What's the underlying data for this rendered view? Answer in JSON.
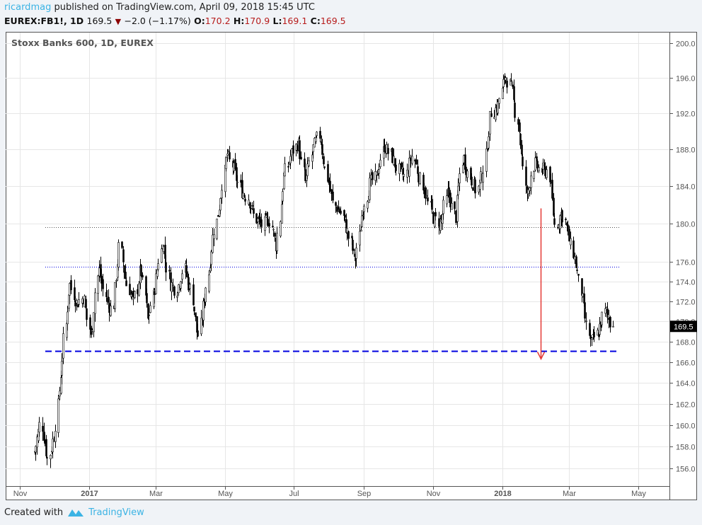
{
  "header": {
    "user": "ricardmag",
    "published": "published on TradingView.com, April 09, 2018 15:45 UTC",
    "symbol": "EUREX:FB1!, 1D",
    "last": "169.5",
    "change": "−2.0 (−1.17%)",
    "o_label": "O:",
    "o": "170.2",
    "h_label": "H:",
    "h": "170.9",
    "l_label": "L:",
    "l": "169.1",
    "c_label": "C:",
    "c": "169.5"
  },
  "footer": {
    "created_with": "Created with",
    "brand": "TradingView"
  },
  "colors": {
    "accent": "#3bb3e4",
    "down": "#b71c1c",
    "level": "#0000e0",
    "arrow": "#e53935"
  },
  "chart_data": {
    "type": "candlestick",
    "title": "Stoxx Banks 600, 1D, EUREX",
    "y_scale": "log",
    "ylim": [
      154.7,
      201.3
    ],
    "y_ticks": [
      156,
      158,
      160,
      162,
      164,
      166,
      168,
      170,
      172,
      174,
      176,
      180,
      184,
      188,
      192,
      196,
      200
    ],
    "x_ticks": [
      {
        "label": "Nov",
        "date": "2016-11-01",
        "bold": false
      },
      {
        "label": "2017",
        "date": "2017-01-01",
        "bold": true
      },
      {
        "label": "Mar",
        "date": "2017-03-01",
        "bold": false
      },
      {
        "label": "May",
        "date": "2017-05-01",
        "bold": false
      },
      {
        "label": "Jul",
        "date": "2017-07-01",
        "bold": false
      },
      {
        "label": "Sep",
        "date": "2017-09-01",
        "bold": false
      },
      {
        "label": "Nov",
        "date": "2017-11-01",
        "bold": false
      },
      {
        "label": "2018",
        "date": "2018-01-01",
        "bold": true
      },
      {
        "label": "Mar",
        "date": "2018-03-01",
        "bold": false
      },
      {
        "label": "May",
        "date": "2018-05-01",
        "bold": false
      }
    ],
    "start_date": "2016-11-14",
    "end_date": "2018-04-09",
    "close_path": [
      157.5,
      160.3,
      156.9,
      159.4,
      166.5,
      173.9,
      171.8,
      172.5,
      168.3,
      175.4,
      172.5,
      171.1,
      177.6,
      173.9,
      171.8,
      175.4,
      170.0,
      173.9,
      178.3,
      173.9,
      173.2,
      175.4,
      173.2,
      168.3,
      172.5,
      178.3,
      182.0,
      187.6,
      185.7,
      183.5,
      182.7,
      180.5,
      179.8,
      180.5,
      177.6,
      185.0,
      187.3,
      188.8,
      184.2,
      188.0,
      189.6,
      185.0,
      182.0,
      181.2,
      179.0,
      176.1,
      181.2,
      184.2,
      185.0,
      188.4,
      187.3,
      185.7,
      185.0,
      187.3,
      185.0,
      182.7,
      180.5,
      180.1,
      183.5,
      180.5,
      187.3,
      185.0,
      183.5,
      185.7,
      192.0,
      192.8,
      196.4,
      194.4,
      189.6,
      182.7,
      186.5,
      185.7,
      185.7,
      179.8,
      181.2,
      178.3,
      175.4,
      171.1,
      167.6,
      169.0,
      171.1,
      169.5
    ],
    "last_price": 169.5,
    "last_price_label": "169.5",
    "levels": [
      {
        "price": 179.6,
        "style": "dotted",
        "color": "#555555"
      },
      {
        "price": 175.5,
        "style": "dotted",
        "color": "#0000e0"
      },
      {
        "price": 167.1,
        "style": "dashed",
        "color": "#0000e0"
      }
    ],
    "arrow": {
      "date": "2018-02-04",
      "from_price": 181.6,
      "to_price": 166.3,
      "color": "#e53935"
    },
    "grid": true
  }
}
